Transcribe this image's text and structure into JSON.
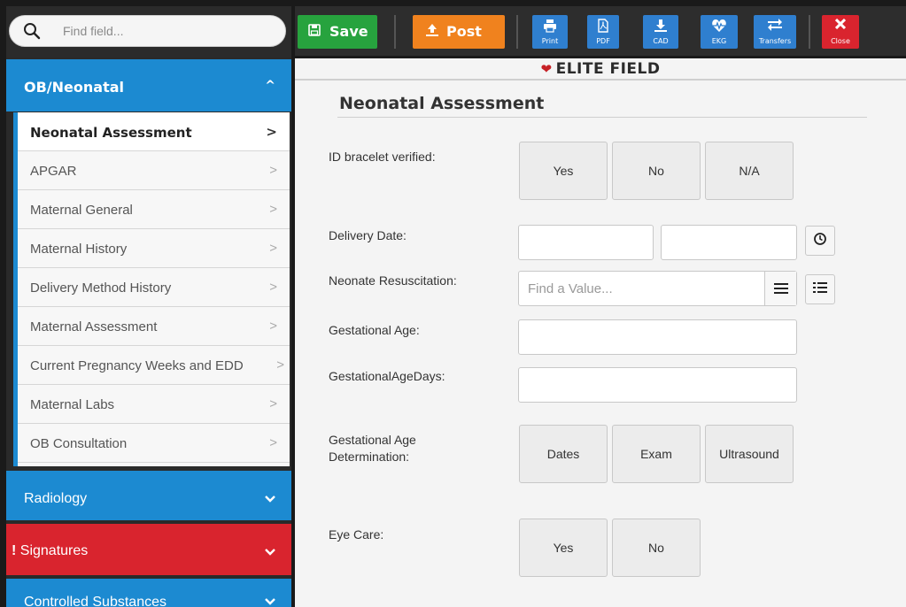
{
  "search": {
    "placeholder": "Find field..."
  },
  "sidebar": {
    "ob_section": {
      "label": "OB/Neonatal",
      "chevron": "^"
    },
    "items": [
      {
        "label": "Neonatal Assessment",
        "active": true
      },
      {
        "label": "APGAR"
      },
      {
        "label": "Maternal General"
      },
      {
        "label": "Maternal History"
      },
      {
        "label": "Delivery Method History"
      },
      {
        "label": "Maternal Assessment"
      },
      {
        "label": "Current Pregnancy Weeks and EDD"
      },
      {
        "label": "Maternal Labs"
      },
      {
        "label": "OB Consultation"
      }
    ],
    "chevron_right": ">",
    "radiology": {
      "label": "Radiology"
    },
    "signatures": {
      "label": "Signatures",
      "alert": "!"
    },
    "controlled": {
      "label": "Controlled Substances"
    },
    "chevron_down": "⌄"
  },
  "toolbar": {
    "save": "Save",
    "post": "Post",
    "print": "Print",
    "pdf": "PDF",
    "cad": "CAD",
    "ekg": "EKG",
    "transfers": "Transfers",
    "close": "Close"
  },
  "main": {
    "brand": "ELITE FIELD",
    "title": "Neonatal Assessment",
    "fields": {
      "id_bracelet": {
        "label": "ID bracelet verified:",
        "options": [
          "Yes",
          "No",
          "N/A"
        ]
      },
      "delivery_date": {
        "label": "Delivery Date:"
      },
      "neonate_resus": {
        "label": "Neonate Resuscitation:",
        "placeholder": "Find a Value..."
      },
      "gest_age": {
        "label": "Gestational Age:"
      },
      "gest_age_days": {
        "label": "GestationalAgeDays:"
      },
      "gest_age_det": {
        "label": "Gestational Age Determination:",
        "options": [
          "Dates",
          "Exam",
          "Ultrasound"
        ]
      },
      "eye_care": {
        "label": "Eye Care:",
        "options": [
          "Yes",
          "No"
        ]
      }
    }
  },
  "colors": {
    "accent_blue": "#1c8ad1",
    "save_green": "#27a33e",
    "post_orange": "#f0821e",
    "alert_red": "#d9242e",
    "toolbar_blue": "#2f7fcf"
  }
}
